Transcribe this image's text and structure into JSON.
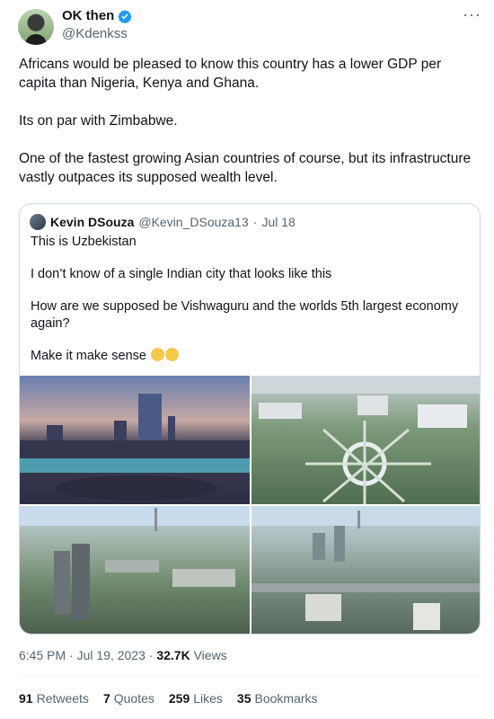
{
  "author": {
    "display_name": "OK then",
    "handle": "@Kdenkss"
  },
  "more_label": "···",
  "tweet_paragraphs": [
    "Africans would be pleased to know this country has a lower GDP per capita than Nigeria, Kenya and Ghana.",
    "Its on par with Zimbabwe.",
    "One of the fastest growing Asian countries of course, but its infrastructure vastly outpaces its supposed wealth level."
  ],
  "quote": {
    "display_name": "Kevin DSouza",
    "handle": "@Kevin_DSouza13",
    "separator": "·",
    "date": "Jul 18",
    "paragraphs": [
      "This is Uzbekistan",
      "I don’t know of a single Indian city that looks like this",
      "How are we supposed be Vishwaguru and the worlds 5th largest economy again?",
      "Make it make sense"
    ],
    "emoji": [
      "neutral-face-emoji",
      "smiling-heart-eyes-emoji"
    ]
  },
  "timestamp": {
    "time": "6:45 PM",
    "separator": "·",
    "date": "Jul 19, 2023",
    "views_count": "32.7K",
    "views_label": "Views"
  },
  "stats": [
    {
      "count": "91",
      "label": "Retweets"
    },
    {
      "count": "7",
      "label": "Quotes"
    },
    {
      "count": "259",
      "label": "Likes"
    },
    {
      "count": "35",
      "label": "Bookmarks"
    }
  ],
  "colors": {
    "text": "#0f1419",
    "secondary": "#536471",
    "verified": "#1d9bf0",
    "border": "#cfd9de"
  }
}
